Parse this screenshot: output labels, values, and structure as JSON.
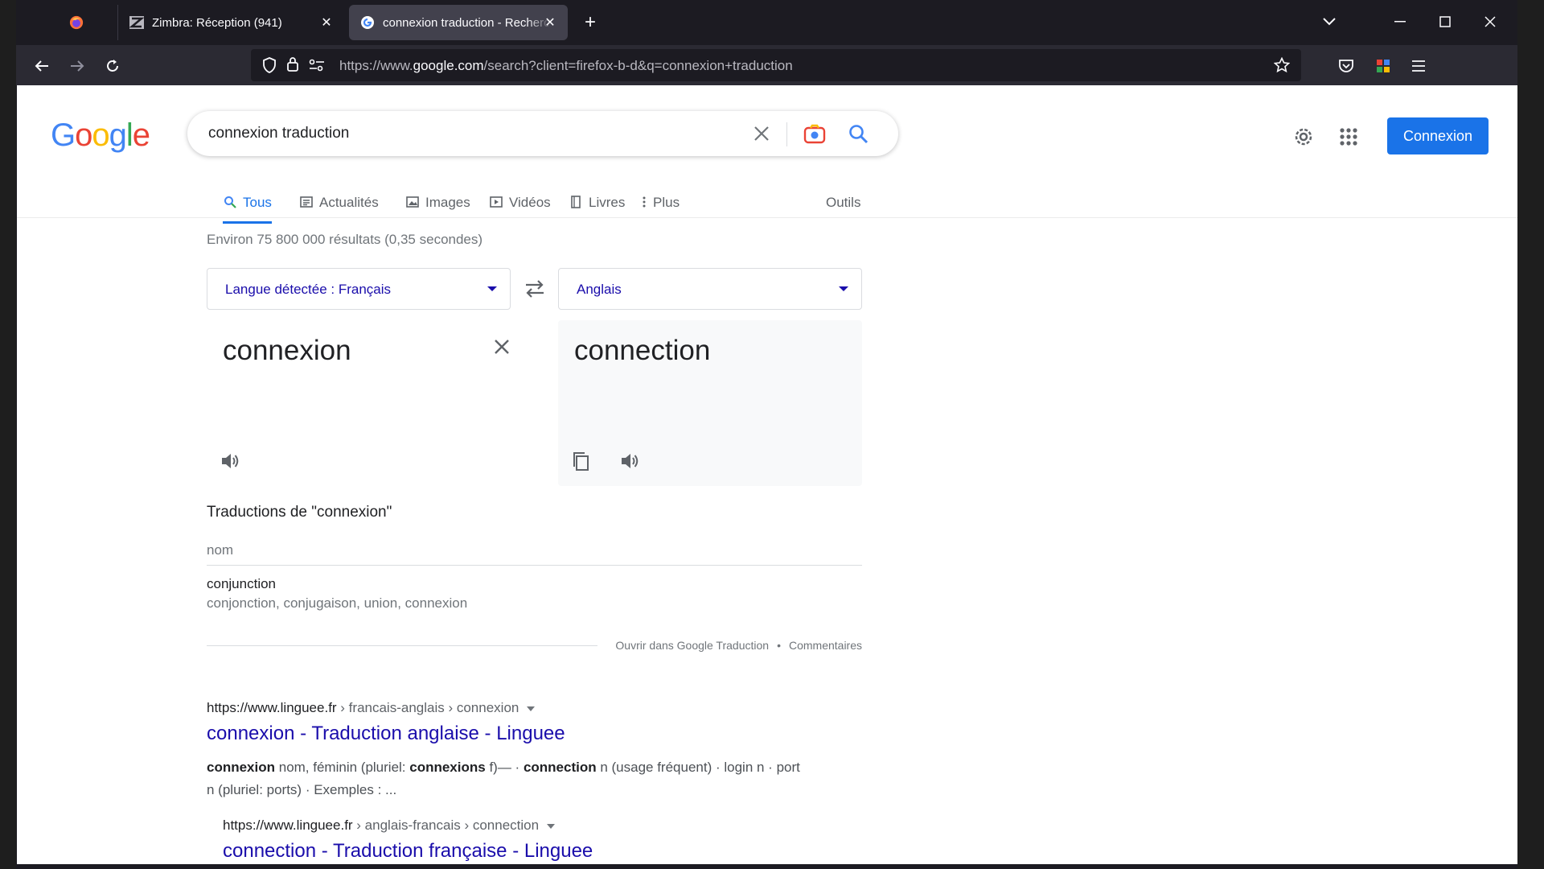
{
  "browser": {
    "tabs": [
      {
        "label": "",
        "icon": "firefox-icon"
      },
      {
        "label": "Zimbra: Réception (941)",
        "icon": "zimbra-icon"
      },
      {
        "label": "connexion traduction - Recherche",
        "icon": "google-icon"
      }
    ],
    "url_prefix": "https://www.",
    "url_domain": "google.com",
    "url_suffix": "/search?client=firefox-b-d&q=connexion+traduction"
  },
  "google": {
    "logo": [
      "G",
      "o",
      "o",
      "g",
      "l",
      "e"
    ],
    "search_query": "connexion traduction",
    "signin_label": "Connexion",
    "tabs": [
      {
        "label": "Tous",
        "icon": "search-icon"
      },
      {
        "label": "Actualités",
        "icon": "news-icon"
      },
      {
        "label": "Images",
        "icon": "image-icon"
      },
      {
        "label": "Vidéos",
        "icon": "video-icon"
      },
      {
        "label": "Livres",
        "icon": "book-icon"
      },
      {
        "label": "Plus",
        "icon": "more-vert-icon"
      }
    ],
    "tools_label": "Outils",
    "result_stats": "Environ 75 800 000 résultats (0,35 secondes)"
  },
  "translate": {
    "source_lang": "Langue détectée : Français",
    "target_lang": "Anglais",
    "source_text": "connexion",
    "target_text": "connection",
    "heading": "Traductions de \"connexion\"",
    "pos": "nom",
    "entry_word": "conjunction",
    "entry_synonyms": "conjonction, conjugaison, union, connexion",
    "open_link": "Ouvrir dans Google Traduction",
    "feedback_link": "Commentaires",
    "separator": "•"
  },
  "results": [
    {
      "url_site": "https://www.linguee.fr",
      "url_path": " › francais-anglais › connexion",
      "title": "connexion - Traduction anglaise - Linguee",
      "snippet": {
        "w1": "connexion",
        "t1": " nom, féminin (pluriel: ",
        "w2": "connexions",
        "t2": " f)— · ",
        "w3": "connection",
        "t3": " n (usage fréquent) · login n · port n (pluriel: ports) · Exemples : ..."
      }
    },
    {
      "url_site": "https://www.linguee.fr",
      "url_path": " › anglais-francais › connection",
      "title": "connection - Traduction française - Linguee"
    }
  ],
  "colors": {
    "accent": "#1a73e8",
    "link": "#1a0dab",
    "chrome_bg": "#1c1b22",
    "toolbar_bg": "#2b2a33"
  }
}
